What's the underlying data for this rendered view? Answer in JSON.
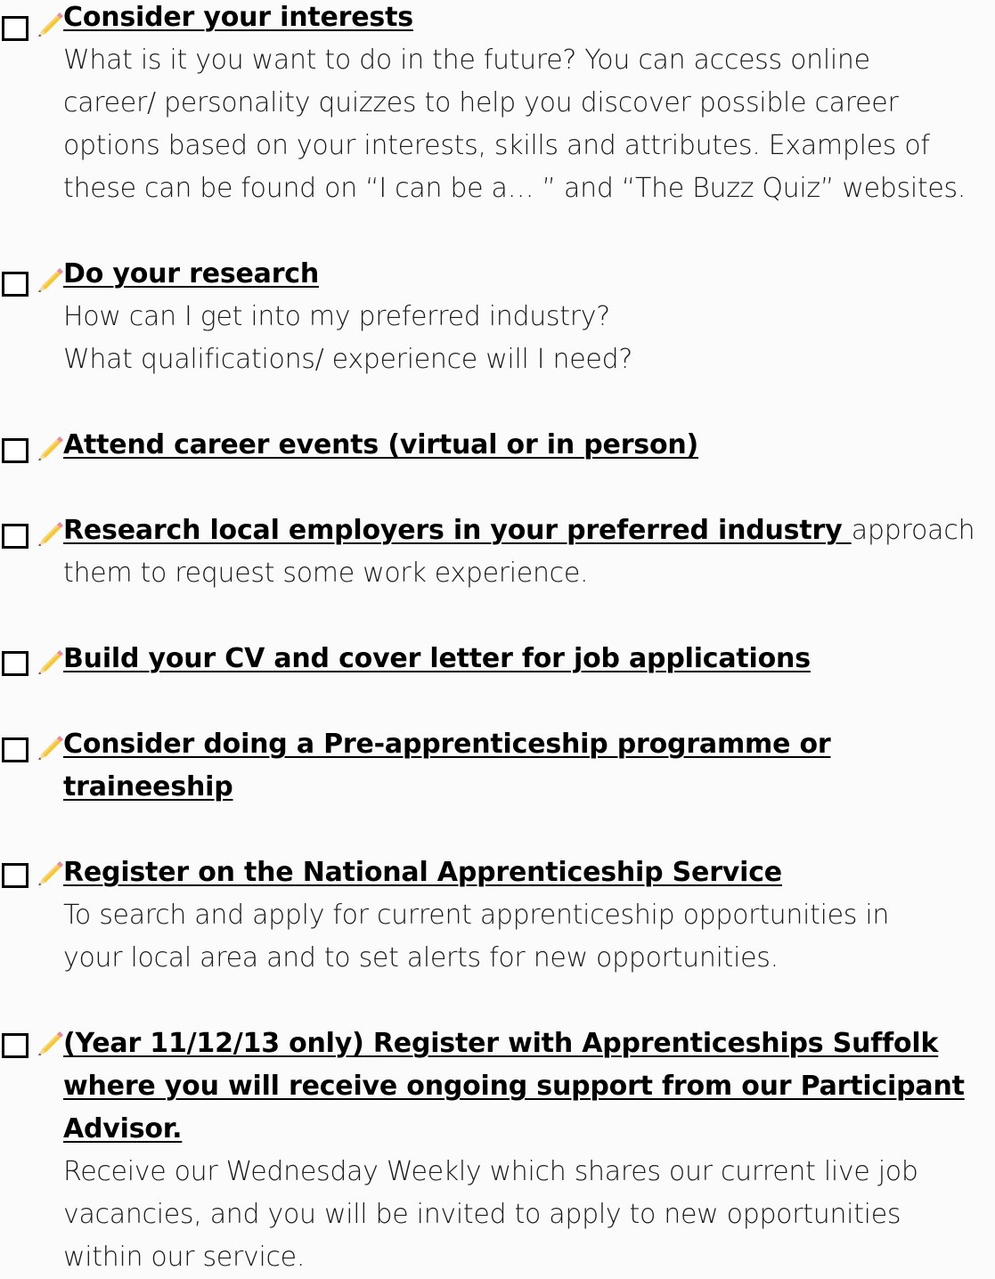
{
  "items": [
    {
      "heading": "Consider your interests",
      "desc_lines": [
        "What is it you want to do in the future? You can access online",
        "career/ personality quizzes to help you discover possible career",
        "options based on your interests, skills and attributes. Examples of",
        "these can be found on “I can be a… ” and “The Buzz Quiz” websites."
      ]
    },
    {
      "heading": "Do your research",
      "desc_lines": [
        "How can I get into my preferred industry?",
        "What qualifications/ experience will I need?"
      ]
    },
    {
      "heading": "Attend career events (virtual or in person)"
    },
    {
      "heading": "Research local employers in your preferred industry",
      "inline_text": "approach",
      "desc_lines": [
        "them to request some work experience."
      ]
    },
    {
      "heading": "Build your CV and cover letter for job applications"
    },
    {
      "heading_lines": [
        "Consider doing a Pre-apprenticeship programme or",
        "traineeship"
      ]
    },
    {
      "heading": "Register on the National Apprenticeship Service",
      "desc_lines": [
        "To search and apply for current apprenticeship opportunities in",
        "your local area and to set alerts for new opportunities."
      ]
    },
    {
      "heading_part1": "(Year 11/12/13 only)",
      "heading_part2": "Register with Apprenticeships Suffolk",
      "heading_lines": [
        "where you will receive ongoing support from our Participant",
        "Advisor."
      ],
      "desc_lines": [
        "Receive our Wednesday Weekly which shares our current live job",
        "vacancies, and you will be invited to apply to new opportunities",
        "within our service."
      ]
    }
  ]
}
